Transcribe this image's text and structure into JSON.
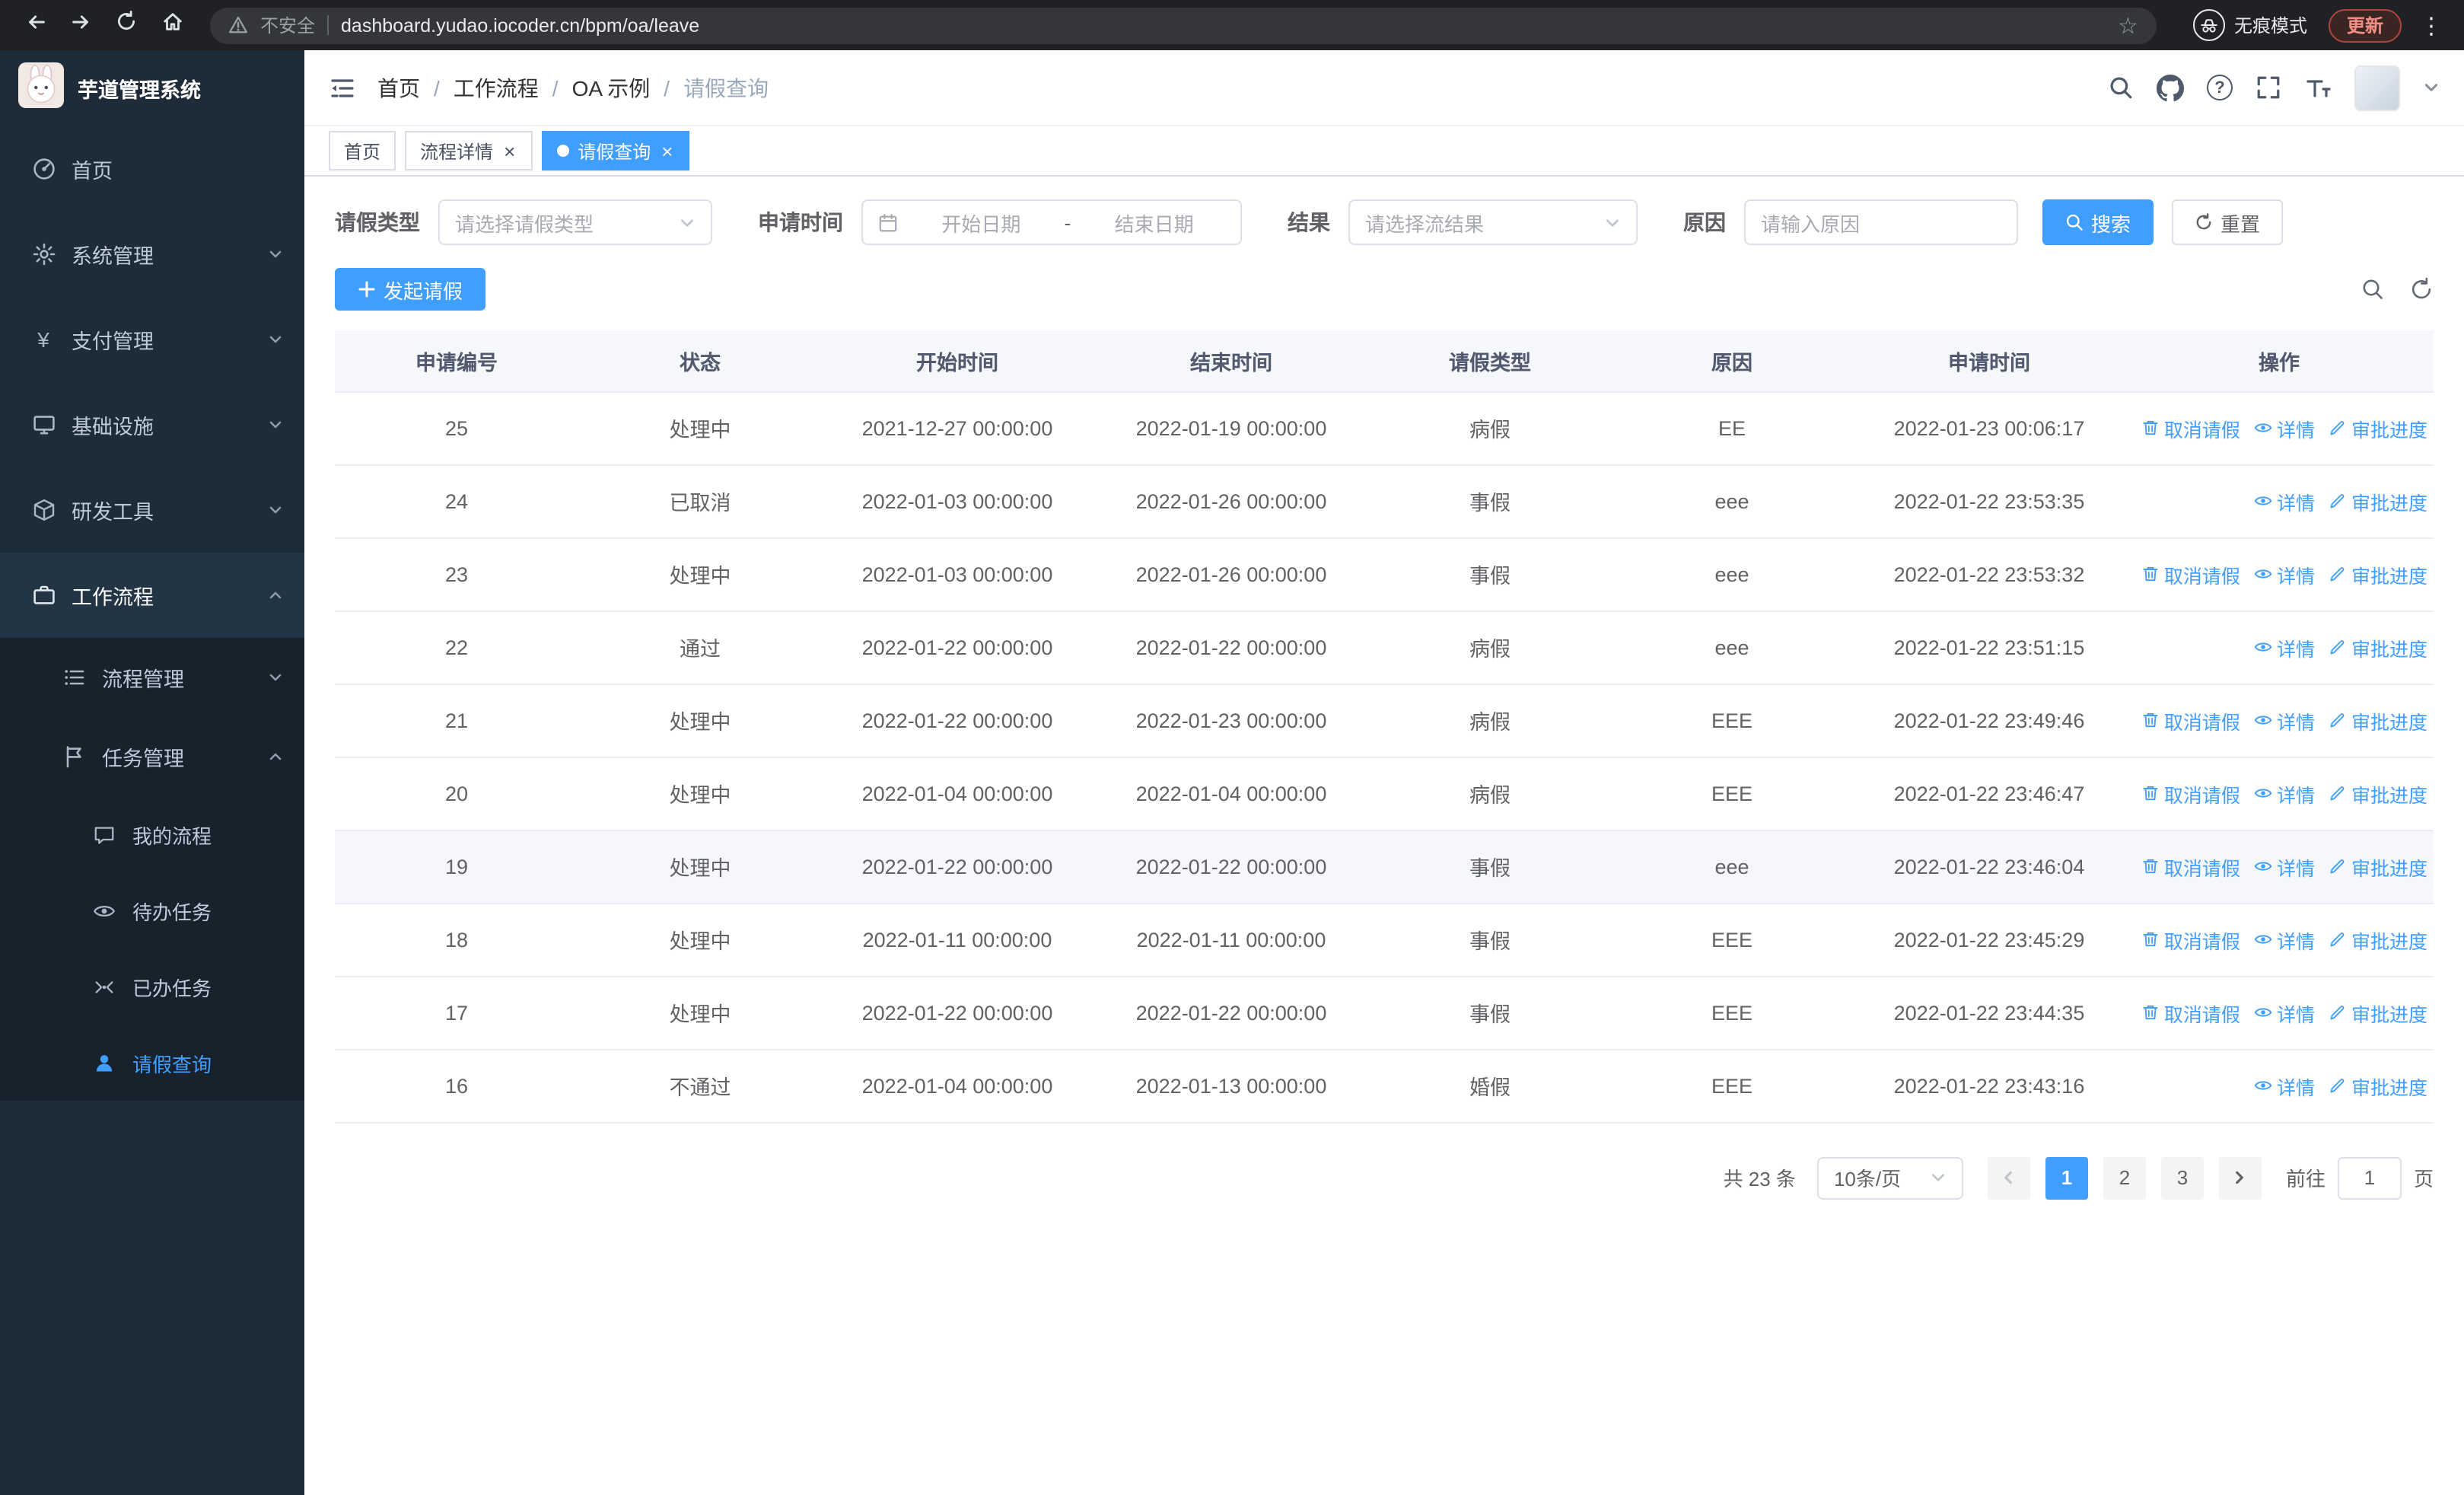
{
  "browser": {
    "security_label": "不安全",
    "url": "dashboard.yudao.iocoder.cn/bpm/oa/leave",
    "incognito_label": "无痕模式",
    "update_label": "更新"
  },
  "glyphs": {
    "star": "☆",
    "menu_dots": "⋮",
    "close": "×",
    "currency": "¥",
    "question": "?"
  },
  "sidebar": {
    "logo_title": "芋道管理系统",
    "items": [
      {
        "label": "首页"
      },
      {
        "label": "系统管理"
      },
      {
        "label": "支付管理"
      },
      {
        "label": "基础设施"
      },
      {
        "label": "研发工具"
      },
      {
        "label": "工作流程"
      },
      {
        "label": "流程管理"
      },
      {
        "label": "任务管理"
      },
      {
        "label": "我的流程"
      },
      {
        "label": "待办任务"
      },
      {
        "label": "已办任务"
      },
      {
        "label": "请假查询"
      }
    ]
  },
  "breadcrumb": {
    "separator": "/",
    "items": [
      "首页",
      "工作流程",
      "OA 示例",
      "请假查询"
    ]
  },
  "tabs": [
    {
      "label": "首页"
    },
    {
      "label": "流程详情"
    },
    {
      "label": "请假查询"
    }
  ],
  "filters": {
    "leave_type_label": "请假类型",
    "leave_type_placeholder": "请选择请假类型",
    "apply_time_label": "申请时间",
    "start_date_placeholder": "开始日期",
    "date_separator": "-",
    "end_date_placeholder": "结束日期",
    "result_label": "结果",
    "result_placeholder": "请选择流结果",
    "reason_label": "原因",
    "reason_placeholder": "请输入原因",
    "search_label": "搜索",
    "reset_label": "重置"
  },
  "toolbar": {
    "create_label": "发起请假"
  },
  "table": {
    "columns": [
      "申请编号",
      "状态",
      "开始时间",
      "结束时间",
      "请假类型",
      "原因",
      "申请时间",
      "操作"
    ],
    "action_labels": {
      "cancel": "取消请假",
      "detail": "详情",
      "progress": "审批进度"
    },
    "rows": [
      {
        "id": "25",
        "status": "处理中",
        "start": "2021-12-27 00:00:00",
        "end": "2022-01-19 00:00:00",
        "type": "病假",
        "reason": "EE",
        "apply_time": "2022-01-23 00:06:17",
        "actions": [
          "cancel",
          "detail",
          "progress"
        ]
      },
      {
        "id": "24",
        "status": "已取消",
        "start": "2022-01-03 00:00:00",
        "end": "2022-01-26 00:00:00",
        "type": "事假",
        "reason": "eee",
        "apply_time": "2022-01-22 23:53:35",
        "actions": [
          "detail",
          "progress"
        ]
      },
      {
        "id": "23",
        "status": "处理中",
        "start": "2022-01-03 00:00:00",
        "end": "2022-01-26 00:00:00",
        "type": "事假",
        "reason": "eee",
        "apply_time": "2022-01-22 23:53:32",
        "actions": [
          "cancel",
          "detail",
          "progress"
        ]
      },
      {
        "id": "22",
        "status": "通过",
        "start": "2022-01-22 00:00:00",
        "end": "2022-01-22 00:00:00",
        "type": "病假",
        "reason": "eee",
        "apply_time": "2022-01-22 23:51:15",
        "actions": [
          "detail",
          "progress"
        ]
      },
      {
        "id": "21",
        "status": "处理中",
        "start": "2022-01-22 00:00:00",
        "end": "2022-01-23 00:00:00",
        "type": "病假",
        "reason": "EEE",
        "apply_time": "2022-01-22 23:49:46",
        "actions": [
          "cancel",
          "detail",
          "progress"
        ]
      },
      {
        "id": "20",
        "status": "处理中",
        "start": "2022-01-04 00:00:00",
        "end": "2022-01-04 00:00:00",
        "type": "病假",
        "reason": "EEE",
        "apply_time": "2022-01-22 23:46:47",
        "actions": [
          "cancel",
          "detail",
          "progress"
        ]
      },
      {
        "id": "19",
        "status": "处理中",
        "start": "2022-01-22 00:00:00",
        "end": "2022-01-22 00:00:00",
        "type": "事假",
        "reason": "eee",
        "apply_time": "2022-01-22 23:46:04",
        "actions": [
          "cancel",
          "detail",
          "progress"
        ],
        "highlight": true
      },
      {
        "id": "18",
        "status": "处理中",
        "start": "2022-01-11 00:00:00",
        "end": "2022-01-11 00:00:00",
        "type": "事假",
        "reason": "EEE",
        "apply_time": "2022-01-22 23:45:29",
        "actions": [
          "cancel",
          "detail",
          "progress"
        ]
      },
      {
        "id": "17",
        "status": "处理中",
        "start": "2022-01-22 00:00:00",
        "end": "2022-01-22 00:00:00",
        "type": "事假",
        "reason": "EEE",
        "apply_time": "2022-01-22 23:44:35",
        "actions": [
          "cancel",
          "detail",
          "progress"
        ]
      },
      {
        "id": "16",
        "status": "不通过",
        "start": "2022-01-04 00:00:00",
        "end": "2022-01-13 00:00:00",
        "type": "婚假",
        "reason": "EEE",
        "apply_time": "2022-01-22 23:43:16",
        "actions": [
          "detail",
          "progress"
        ]
      }
    ]
  },
  "pagination": {
    "total_label": "共 23 条",
    "page_size": "10条/页",
    "pages": [
      "1",
      "2",
      "3"
    ],
    "active_page": "1",
    "goto_label": "前往",
    "goto_value": "1",
    "page_unit_label": "页"
  },
  "colors": {
    "accent": "#409eff",
    "sidebar_bg": "#1e2b38",
    "browser_bg": "#202124"
  },
  "icons": [
    "back-icon",
    "forward-icon",
    "reload-icon",
    "home-icon",
    "warning-icon",
    "star-icon",
    "incognito-icon",
    "menu-dots-icon",
    "hamburger-fold-icon",
    "search-icon",
    "github-icon",
    "help-icon",
    "fullscreen-icon",
    "font-size-icon",
    "chevron-down-icon",
    "calendar-icon",
    "plus-icon",
    "refresh-icon",
    "delete-icon",
    "eye-icon",
    "edit-icon",
    "dashboard-icon",
    "gear-icon",
    "yen-icon",
    "monitor-icon",
    "cube-icon",
    "briefcase-icon",
    "list-icon",
    "flag-icon",
    "chat-icon",
    "check-circle-icon",
    "user-icon"
  ]
}
